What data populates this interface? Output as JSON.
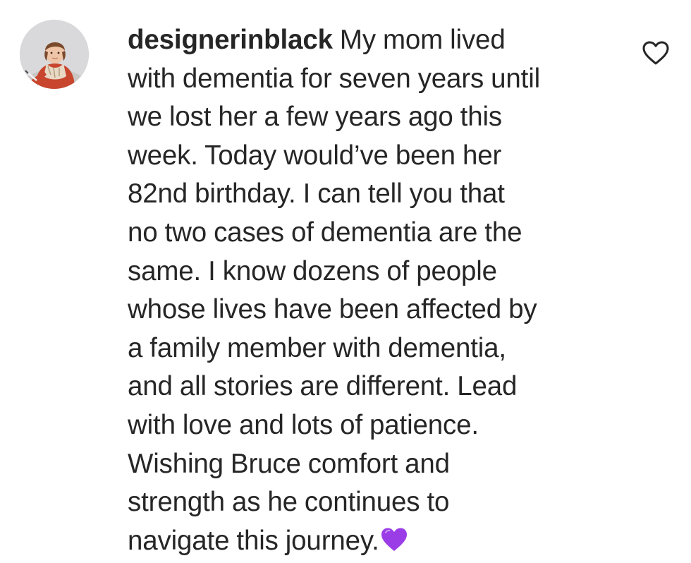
{
  "comment": {
    "author": {
      "username": "designerinblack",
      "avatar_icon": "profile-photo-avatar"
    },
    "lines": [
      " My mom lived",
      "with dementia for seven years until",
      "we lost her a few years ago this",
      "week. Today would’ve been her",
      "82nd birthday. I can tell you that",
      "no two cases of dementia are the",
      "same. I know dozens of people",
      "whose lives have been affected by",
      "a family member with dementia,",
      "and all stories are different. Lead",
      "with love and lots of patience.",
      "Wishing Bruce comfort and",
      "strength as he continues to",
      "navigate this journey."
    ],
    "emoji": "purple-heart",
    "like_icon": "heart-outline-icon"
  },
  "colors": {
    "text": "#262626",
    "emoji": "#9b3de6"
  }
}
